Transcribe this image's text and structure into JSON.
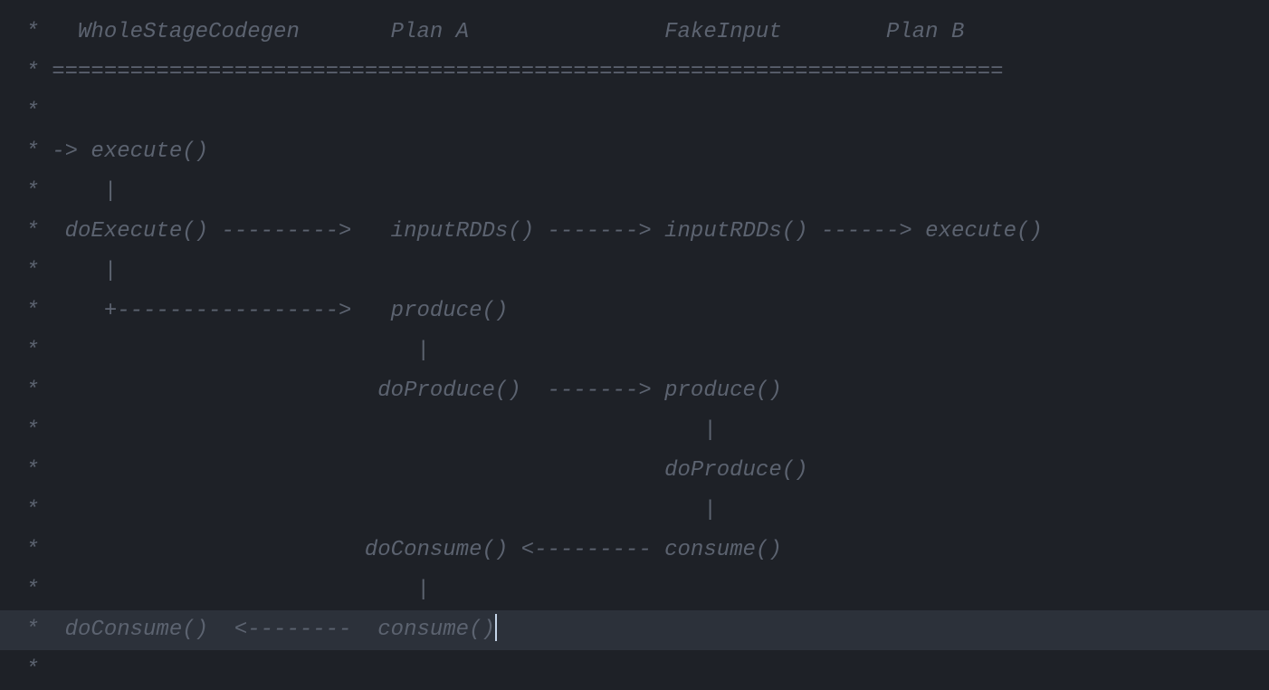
{
  "lines": [
    " *   WholeStageCodegen       Plan A               FakeInput        Plan B",
    " * =========================================================================",
    " *",
    " * -> execute()",
    " *     |",
    " *  doExecute() --------->   inputRDDs() -------> inputRDDs() ------> execute()",
    " *     |",
    " *     +----------------->   produce()",
    " *                             |",
    " *                          doProduce()  -------> produce()",
    " *                                                   |",
    " *                                                doProduce()",
    " *                                                   |",
    " *                         doConsume() <--------- consume()",
    " *                             |",
    " *  doConsume()  <--------  consume()",
    " *"
  ],
  "current_line_index": 15
}
